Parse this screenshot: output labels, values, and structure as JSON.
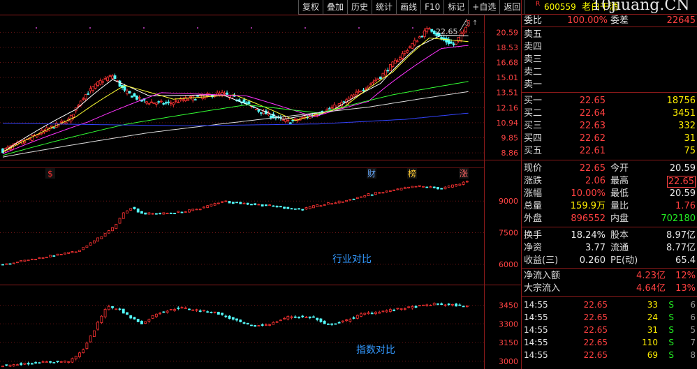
{
  "toolbar": {
    "buttons": [
      "复权",
      "叠加",
      "历史",
      "统计",
      "画线",
      "F10",
      "标记",
      "+自选",
      "返回"
    ]
  },
  "stock": {
    "flag": "R",
    "code": "600559",
    "name": "老白干酒",
    "watermark": "10jiuang.CN"
  },
  "main_chart": {
    "price_axis": [
      "20.59",
      "18.53",
      "16.68",
      "15.01",
      "13.51",
      "12.16",
      "10.94",
      "9.85",
      "8.86"
    ],
    "high_label": "22.65",
    "markers": [
      {
        "text": "$",
        "color": "#ff3333"
      },
      {
        "text": "财",
        "color": "#66aaff"
      },
      {
        "text": "榜",
        "color": "#ffcc33"
      },
      {
        "text": "涨",
        "color": "#ff6666"
      }
    ]
  },
  "industry_chart": {
    "label": "行业对比",
    "axis": [
      "9000",
      "7500",
      "6000"
    ]
  },
  "index_chart": {
    "label": "指数对比",
    "axis": [
      "3450",
      "3300",
      "3150",
      "3000"
    ]
  },
  "chart_data": [
    {
      "type": "candlestick",
      "name": "老白干酒",
      "ylim": [
        8.4,
        23.2
      ],
      "close_anchors": [
        [
          0,
          9.0
        ],
        [
          20,
          9.7
        ],
        [
          40,
          10.6
        ],
        [
          55,
          11.2
        ],
        [
          65,
          13.0
        ],
        [
          80,
          14.6
        ],
        [
          90,
          15.2
        ],
        [
          100,
          13.6
        ],
        [
          115,
          12.7
        ],
        [
          135,
          12.5
        ],
        [
          150,
          12.9
        ],
        [
          165,
          13.2
        ],
        [
          180,
          13.4
        ],
        [
          195,
          12.8
        ],
        [
          210,
          11.9
        ],
        [
          225,
          11.3
        ],
        [
          235,
          11.0
        ],
        [
          250,
          11.4
        ],
        [
          265,
          11.9
        ],
        [
          280,
          12.6
        ],
        [
          295,
          13.8
        ],
        [
          310,
          15.1
        ],
        [
          325,
          17.2
        ],
        [
          340,
          19.6
        ],
        [
          350,
          21.3
        ],
        [
          360,
          19.6
        ],
        [
          370,
          18.9
        ],
        [
          378,
          20.59
        ],
        [
          382,
          22.65
        ]
      ],
      "ma": [
        {
          "color": "#ffffff",
          "anchors": [
            [
              0,
              8.9
            ],
            [
              60,
              12.0
            ],
            [
              90,
              14.8
            ],
            [
              120,
              13.2
            ],
            [
              180,
              13.3
            ],
            [
              230,
              11.2
            ],
            [
              270,
              11.9
            ],
            [
              310,
              14.4
            ],
            [
              340,
              18.6
            ],
            [
              360,
              20.2
            ],
            [
              382,
              20.1
            ]
          ]
        },
        {
          "color": "#ffff33",
          "anchors": [
            [
              0,
              8.9
            ],
            [
              60,
              11.4
            ],
            [
              100,
              14.2
            ],
            [
              140,
              12.9
            ],
            [
              190,
              13.3
            ],
            [
              240,
              11.1
            ],
            [
              280,
              12.2
            ],
            [
              320,
              15.6
            ],
            [
              350,
              19.8
            ],
            [
              382,
              19.3
            ]
          ]
        },
        {
          "color": "#ff33ff",
          "anchors": [
            [
              0,
              8.8
            ],
            [
              70,
              11.0
            ],
            [
              130,
              13.5
            ],
            [
              200,
              13.2
            ],
            [
              255,
              11.4
            ],
            [
              300,
              12.7
            ],
            [
              335,
              16.0
            ],
            [
              360,
              18.4
            ],
            [
              382,
              18.8
            ]
          ]
        },
        {
          "color": "#33ff33",
          "anchors": [
            [
              0,
              8.7
            ],
            [
              100,
              10.8
            ],
            [
              200,
              12.4
            ],
            [
              260,
              11.7
            ],
            [
              320,
              13.3
            ],
            [
              382,
              14.6
            ]
          ]
        },
        {
          "color": "#dddddd",
          "anchors": [
            [
              0,
              8.6
            ],
            [
              120,
              10.2
            ],
            [
              230,
              11.4
            ],
            [
              300,
              12.2
            ],
            [
              382,
              13.6
            ]
          ]
        },
        {
          "color": "#3344ff",
          "anchors": [
            [
              0,
              10.9
            ],
            [
              150,
              10.7
            ],
            [
              260,
              10.85
            ],
            [
              330,
              11.2
            ],
            [
              382,
              11.7
            ]
          ]
        }
      ]
    },
    {
      "type": "candlestick",
      "name": "行业对比",
      "ylim": [
        5300,
        10000
      ],
      "close_anchors": [
        [
          0,
          6000
        ],
        [
          20,
          6200
        ],
        [
          40,
          6400
        ],
        [
          60,
          6600
        ],
        [
          75,
          7100
        ],
        [
          90,
          7700
        ],
        [
          100,
          8500
        ],
        [
          105,
          8700
        ],
        [
          115,
          8400
        ],
        [
          130,
          8400
        ],
        [
          150,
          8500
        ],
        [
          165,
          8700
        ],
        [
          180,
          9000
        ],
        [
          195,
          8900
        ],
        [
          215,
          8800
        ],
        [
          230,
          8700
        ],
        [
          245,
          8600
        ],
        [
          260,
          8800
        ],
        [
          280,
          9000
        ],
        [
          300,
          9300
        ],
        [
          320,
          9500
        ],
        [
          340,
          9700
        ],
        [
          360,
          9600
        ],
        [
          375,
          9800
        ],
        [
          382,
          10000
        ]
      ]
    },
    {
      "type": "candlestick",
      "name": "指数对比",
      "ylim": [
        2960,
        3520
      ],
      "close_anchors": [
        [
          0,
          2965
        ],
        [
          30,
          2990
        ],
        [
          55,
          3000
        ],
        [
          65,
          3080
        ],
        [
          75,
          3250
        ],
        [
          85,
          3440
        ],
        [
          95,
          3420
        ],
        [
          105,
          3350
        ],
        [
          115,
          3300
        ],
        [
          125,
          3380
        ],
        [
          145,
          3430
        ],
        [
          160,
          3410
        ],
        [
          175,
          3390
        ],
        [
          190,
          3330
        ],
        [
          205,
          3280
        ],
        [
          220,
          3300
        ],
        [
          235,
          3360
        ],
        [
          255,
          3350
        ],
        [
          265,
          3290
        ],
        [
          280,
          3320
        ],
        [
          295,
          3380
        ],
        [
          310,
          3400
        ],
        [
          325,
          3420
        ],
        [
          340,
          3440
        ],
        [
          355,
          3460
        ],
        [
          370,
          3450
        ],
        [
          382,
          3440
        ]
      ]
    }
  ],
  "quote": {
    "webi_label": "委比",
    "webi_value": "100.00%",
    "weicha_label": "委差",
    "weicha_value": "22645",
    "sells": [
      {
        "label": "卖五"
      },
      {
        "label": "卖四"
      },
      {
        "label": "卖三"
      },
      {
        "label": "卖二"
      },
      {
        "label": "卖一"
      }
    ],
    "buys": [
      {
        "label": "买一",
        "price": "22.65",
        "vol": "18756"
      },
      {
        "label": "买二",
        "price": "22.64",
        "vol": "3451"
      },
      {
        "label": "买三",
        "price": "22.63",
        "vol": "332"
      },
      {
        "label": "买四",
        "price": "22.62",
        "vol": "31"
      },
      {
        "label": "买五",
        "price": "22.61",
        "vol": "75"
      }
    ],
    "stats1": [
      {
        "l1": "现价",
        "v1": "22.65",
        "c1": "red",
        "l2": "今开",
        "v2": "20.59",
        "c2": "wht"
      },
      {
        "l1": "涨跌",
        "v1": "2.06",
        "c1": "red",
        "l2": "最高",
        "v2": "22.65",
        "c2": "red",
        "box": true
      },
      {
        "l1": "涨幅",
        "v1": "10.00%",
        "c1": "red",
        "l2": "最低",
        "v2": "20.59",
        "c2": "wht"
      },
      {
        "l1": "总量",
        "v1": "159.9万",
        "c1": "yel",
        "l2": "量比",
        "v2": "1.76",
        "c2": "red"
      },
      {
        "l1": "外盘",
        "v1": "896552",
        "c1": "red",
        "l2": "内盘",
        "v2": "702180",
        "c2": "grn"
      }
    ],
    "stats2": [
      {
        "l1": "换手",
        "v1": "18.24%",
        "c1": "wht",
        "l2": "股本",
        "v2": "8.97亿",
        "c2": "wht"
      },
      {
        "l1": "净资",
        "v1": "3.77",
        "c1": "wht",
        "l2": "流通",
        "v2": "8.77亿",
        "c2": "wht"
      },
      {
        "l1": "收益(三)",
        "v1": "0.260",
        "c1": "wht",
        "l2": "PE(动)",
        "v2": "65.4",
        "c2": "wht"
      }
    ],
    "flows": [
      {
        "label": "净流入额",
        "value": "4.23亿",
        "pct": "12%"
      },
      {
        "label": "大宗流入",
        "value": "4.64亿",
        "pct": "13%"
      }
    ],
    "ticks": [
      {
        "time": "14:55",
        "price": "22.65",
        "vol": "33",
        "flag": "S",
        "num": "6"
      },
      {
        "time": "14:55",
        "price": "22.65",
        "vol": "24",
        "flag": "S",
        "num": "6"
      },
      {
        "time": "14:55",
        "price": "22.65",
        "vol": "31",
        "flag": "S",
        "num": "5"
      },
      {
        "time": "14:55",
        "price": "22.65",
        "vol": "110",
        "flag": "S",
        "num": "7"
      },
      {
        "time": "14:55",
        "price": "22.65",
        "vol": "69",
        "flag": "S",
        "num": "8"
      }
    ]
  }
}
